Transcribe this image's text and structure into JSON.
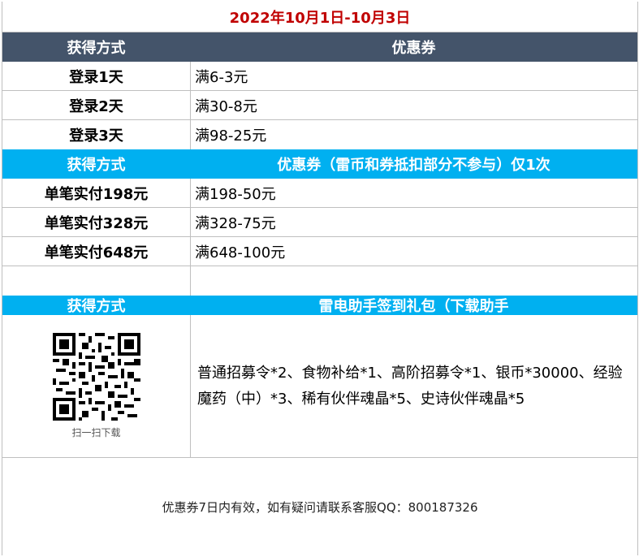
{
  "title": "2022年10月1日-10月3日",
  "section1": {
    "header": {
      "method": "获得方式",
      "reward": "优惠券"
    },
    "rows": [
      {
        "method": "登录1天",
        "reward": "满6-3元"
      },
      {
        "method": "登录2天",
        "reward": "满30-8元"
      },
      {
        "method": "登录3天",
        "reward": "满98-25元"
      }
    ]
  },
  "section2": {
    "header": {
      "method": "获得方式",
      "reward": "优惠券（雷币和券抵扣部分不参与）仅1次"
    },
    "rows": [
      {
        "method": "单笔实付198元",
        "reward": "满198-50元"
      },
      {
        "method": "单笔实付328元",
        "reward": "满328-75元"
      },
      {
        "method": "单笔实付648元",
        "reward": "满648-100元"
      }
    ]
  },
  "section3": {
    "header": {
      "method": "获得方式",
      "reward": "雷电助手签到礼包（下载助手"
    },
    "qr_caption": "扫一扫下载",
    "reward_text": "普通招募令*2、食物补给*1、高阶招募令*1、银币*30000、经验魔药（中）*3、稀有伙伴魂晶*5、史诗伙伴魂晶*5"
  },
  "footer": "优惠券7日内有效，如有疑问请联系客服QQ：800187326",
  "colors": {
    "dark_header": "#44546a",
    "blue_header": "#00b0f0",
    "title": "#c00000"
  }
}
